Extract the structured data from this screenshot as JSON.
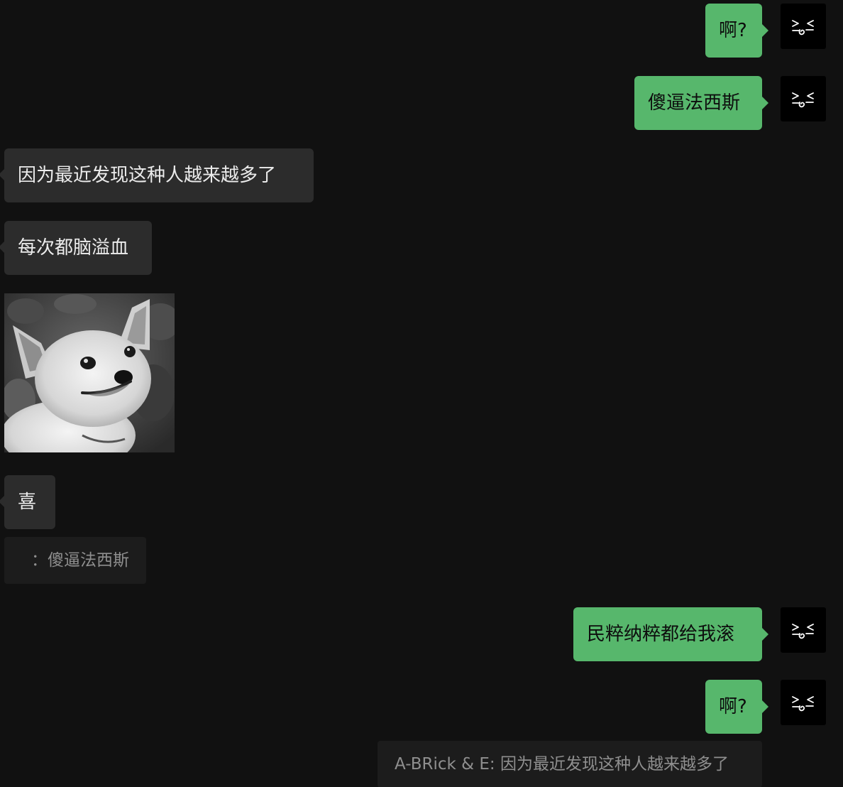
{
  "messages": [
    {
      "side": "out",
      "text": "啊?"
    },
    {
      "side": "out",
      "text": "傻逼法西斯"
    },
    {
      "side": "in",
      "text": "因为最近发现这种人越来越多了"
    },
    {
      "side": "in",
      "text": "每次都脑溢血"
    },
    {
      "side": "in",
      "type": "sticker",
      "icon": "corgi-sticker"
    },
    {
      "side": "in",
      "text": "喜"
    },
    {
      "type": "quote",
      "text": "：傻逼法西斯"
    },
    {
      "side": "out",
      "text": "民粹纳粹都给我滚"
    },
    {
      "side": "out",
      "text": "啊?"
    },
    {
      "type": "quote",
      "text": "A-BRick & E: 因为最近发现这种人越来越多了"
    }
  ],
  "colors": {
    "background": "#111111",
    "outgoing_bubble": "#57b76c",
    "incoming_bubble": "#2c2c2c",
    "quote_bg": "#1c1c1c",
    "avatar_bg": "#000000"
  }
}
